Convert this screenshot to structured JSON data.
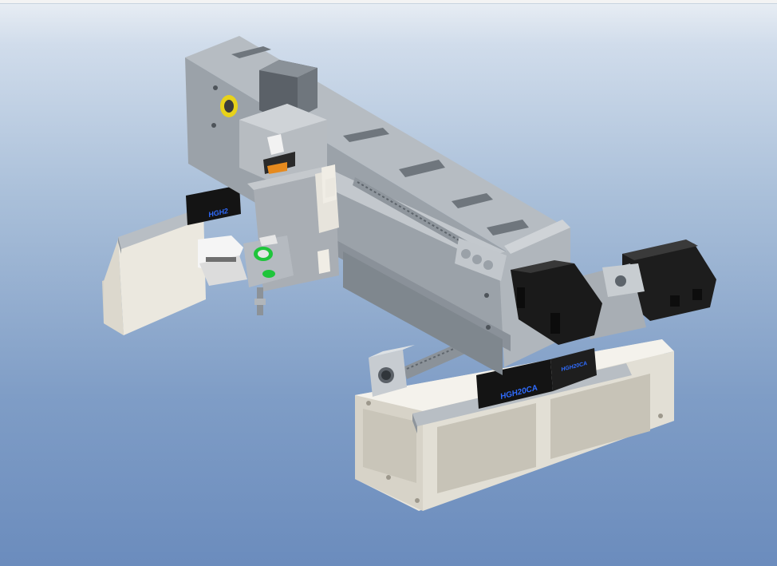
{
  "viewport": {
    "background_top": "#e9eef4",
    "background_bottom": "#6b8cbd"
  },
  "model": {
    "rail_labels": [
      "HGH20CA",
      "HGH20CA",
      "HGH2"
    ],
    "colors": {
      "frame": "#a7aeb6",
      "frame_dark": "#7c848c",
      "frame_light": "#c9ced3",
      "base": "#ece9e1",
      "base_shadow": "#cfcbc0",
      "motor": "#1c1c1c",
      "accent_yellow": "#e8d21a",
      "accent_green": "#1fc53b",
      "accent_orange": "#e68a1e",
      "label_blue": "#2f6cff"
    }
  }
}
